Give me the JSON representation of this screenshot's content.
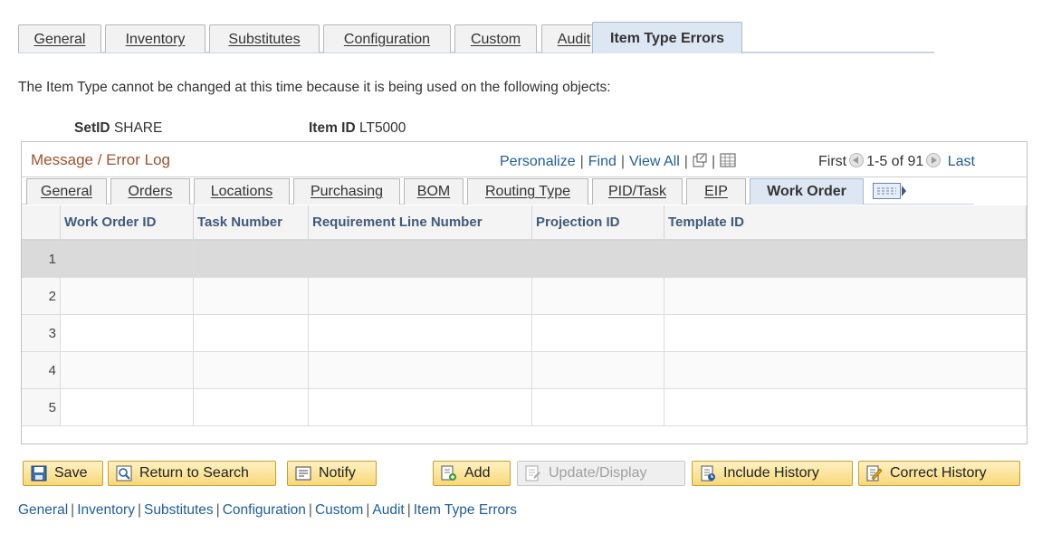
{
  "top_tabs": [
    "General",
    "Inventory",
    "Substitutes",
    "Configuration",
    "Custom",
    "Audit",
    "Item Type Errors"
  ],
  "intro_text": "The Item Type cannot be changed at this time because it is being used on the following objects:",
  "keys": {
    "setid_label": "SetID",
    "setid_value": "SHARE",
    "itemid_label": "Item ID",
    "itemid_value": "LT5000"
  },
  "grid": {
    "title": "Message / Error Log",
    "links": {
      "personalize": "Personalize",
      "find": "Find",
      "view_all": "View All"
    },
    "nav": {
      "first": "First",
      "range": "1-5 of 91",
      "last": "Last"
    },
    "sub_tabs": [
      "General",
      "Orders",
      "Locations",
      "Purchasing",
      "BOM",
      "Routing Type",
      "PID/Task",
      "EIP",
      "Work Order"
    ],
    "columns": [
      "Work Order ID",
      "Task Number",
      "Requirement Line Number",
      "Projection ID",
      "Template ID"
    ],
    "rows": [
      "1",
      "2",
      "3",
      "4",
      "5"
    ]
  },
  "toolbar": {
    "save": "Save",
    "return_to_search": "Return to Search",
    "notify": "Notify",
    "add": "Add",
    "update_display": "Update/Display",
    "include_history": "Include History",
    "correct_history": "Correct History"
  },
  "footer_links": [
    "General",
    "Inventory",
    "Substitutes",
    "Configuration",
    "Custom",
    "Audit",
    "Item Type Errors"
  ],
  "colors": {
    "link": "#1f5e9a",
    "grid_title": "#a0522d",
    "button": "#f7d77a",
    "active_tab": "#dde7f3"
  }
}
